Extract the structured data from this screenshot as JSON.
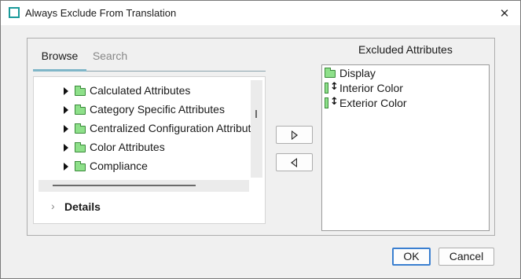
{
  "window": {
    "title": "Always Exclude From Translation",
    "close_symbol": "✕"
  },
  "tabs": [
    {
      "label": "Browse",
      "active": true
    },
    {
      "label": "Search",
      "active": false
    }
  ],
  "tree": {
    "items": [
      {
        "label": "Calculated Attributes",
        "icon": "folder-icon",
        "expandable": true
      },
      {
        "label": "Category Specific Attributes",
        "icon": "folder-icon",
        "expandable": true
      },
      {
        "label": "Centralized Configuration Attribute",
        "icon": "folder-icon",
        "expandable": true
      },
      {
        "label": "Color Attributes",
        "icon": "folder-icon",
        "expandable": true
      },
      {
        "label": "Compliance",
        "icon": "folder-icon",
        "expandable": true
      }
    ]
  },
  "details": {
    "label": "Details",
    "chevron": "›"
  },
  "move_buttons": {
    "add": "move-right-icon",
    "remove": "move-left-icon"
  },
  "excluded": {
    "title": "Excluded Attributes",
    "items": [
      {
        "label": "Display",
        "icon": "folder-icon"
      },
      {
        "label": "Interior Color",
        "icon": "attribute-icon"
      },
      {
        "label": "Exterior Color",
        "icon": "attribute-icon"
      }
    ]
  },
  "footer": {
    "ok_label": "OK",
    "cancel_label": "Cancel"
  },
  "colors": {
    "accent": "#3a7fd0",
    "folder_fill": "#8ee08a",
    "app_icon": "#1a9a9a"
  }
}
